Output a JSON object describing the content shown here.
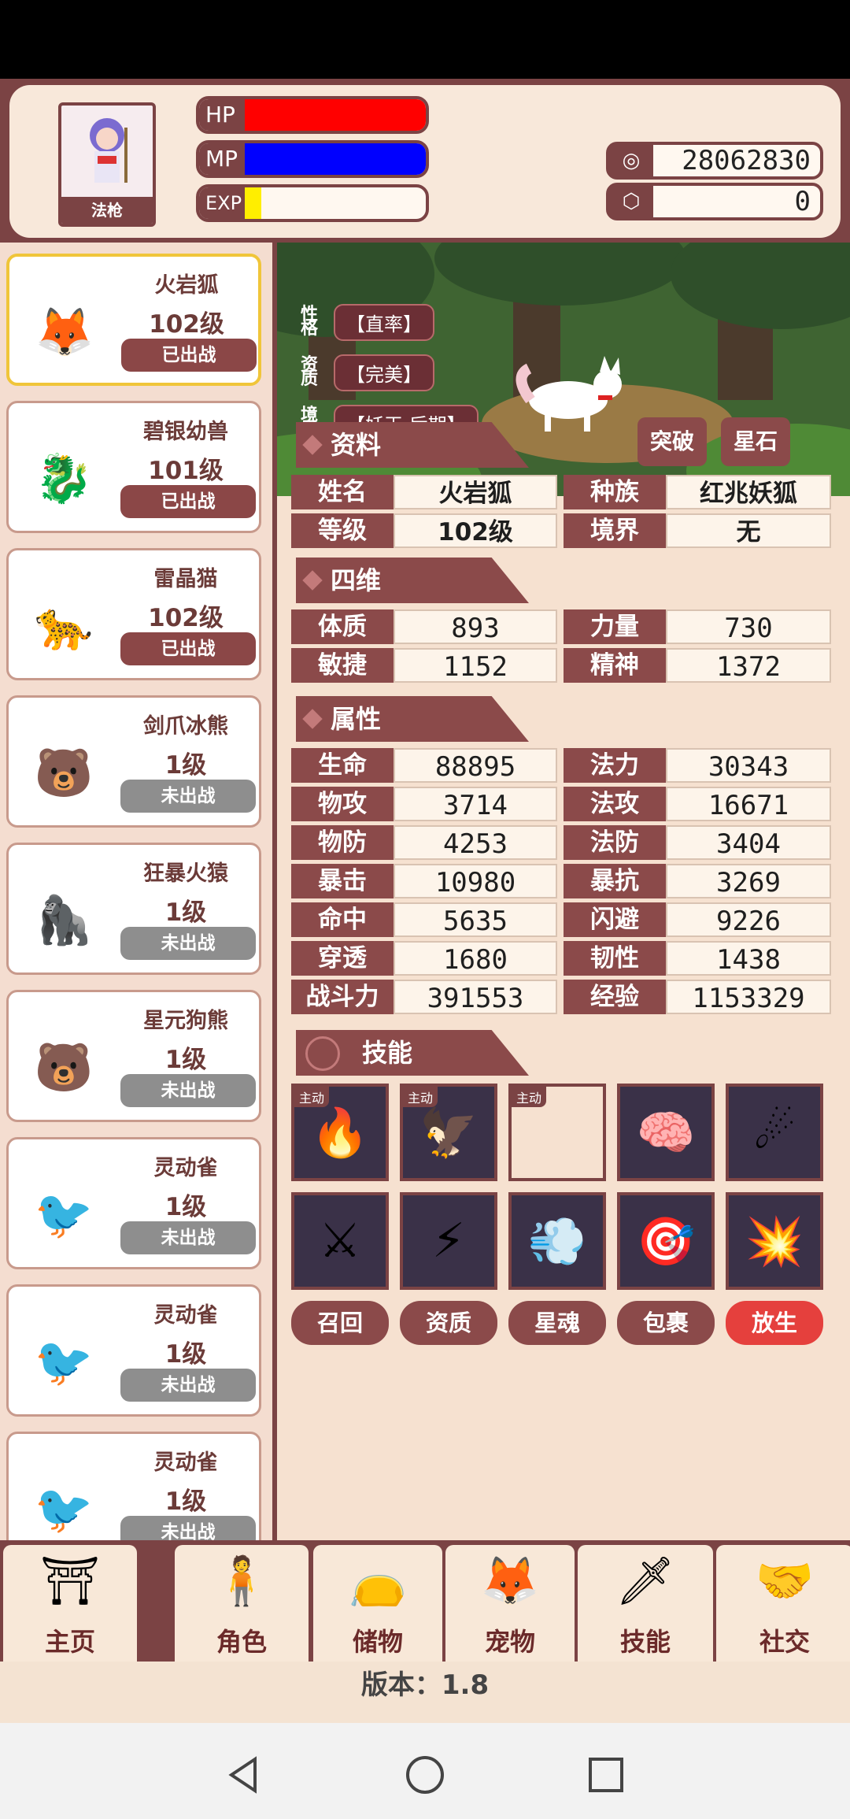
{
  "header": {
    "avatar_label": "法枪",
    "hp_label": "HP",
    "mp_label": "MP",
    "exp_label": "EXP",
    "hp_fill": 1.0,
    "mp_fill": 1.0,
    "exp_fill": 0.09,
    "hp_color": "#ff0000",
    "mp_color": "#0000ff",
    "exp_color": "#ffee00",
    "currency1_icon": "coin-icon",
    "currency1_value": "28062830",
    "currency2_icon": "gem-icon",
    "currency2_value": "0"
  },
  "pets": [
    {
      "name": "火岩狐",
      "level": "102级",
      "status": "已出战",
      "icon": "fox-icon"
    },
    {
      "name": "碧银幼兽",
      "level": "101级",
      "status": "已出战",
      "icon": "silver-beast-icon"
    },
    {
      "name": "雷晶猫",
      "level": "102级",
      "status": "已出战",
      "icon": "thunder-cat-icon"
    },
    {
      "name": "剑爪冰熊",
      "level": "1级",
      "status": "未出战",
      "icon": "ice-bear-icon"
    },
    {
      "name": "狂暴火猿",
      "level": "1级",
      "status": "未出战",
      "icon": "fire-ape-icon"
    },
    {
      "name": "星元狗熊",
      "level": "1级",
      "status": "未出战",
      "icon": "bear-icon"
    },
    {
      "name": "灵动雀",
      "level": "1级",
      "status": "未出战",
      "icon": "sparrow-icon"
    },
    {
      "name": "灵动雀",
      "level": "1级",
      "status": "未出战",
      "icon": "sparrow-icon"
    },
    {
      "name": "灵动雀",
      "level": "1级",
      "status": "未出战",
      "icon": "sparrow-icon"
    }
  ],
  "scene": {
    "traits": [
      {
        "label": "性格",
        "value": "【直率】"
      },
      {
        "label": "资质",
        "value": "【完美】"
      },
      {
        "label": "境界",
        "value": "【妖王·后期】"
      }
    ]
  },
  "info": {
    "section_title": "资料",
    "breakthrough_button": "突破",
    "starstone_button": "星石",
    "rows": [
      {
        "k1": "姓名",
        "v1": "火岩狐",
        "k2": "种族",
        "v2": "红兆妖狐"
      },
      {
        "k1": "等级",
        "v1": "102级",
        "k2": "境界",
        "v2": "无"
      }
    ]
  },
  "four_dims": {
    "section_title": "四维",
    "rows": [
      {
        "k1": "体质",
        "v1": "893",
        "k2": "力量",
        "v2": "730"
      },
      {
        "k1": "敏捷",
        "v1": "1152",
        "k2": "精神",
        "v2": "1372"
      }
    ]
  },
  "attributes": {
    "section_title": "属性",
    "rows": [
      {
        "k1": "生命",
        "v1": "88895",
        "k2": "法力",
        "v2": "30343"
      },
      {
        "k1": "物攻",
        "v1": "3714",
        "k2": "法攻",
        "v2": "16671"
      },
      {
        "k1": "物防",
        "v1": "4253",
        "k2": "法防",
        "v2": "3404"
      },
      {
        "k1": "暴击",
        "v1": "10980",
        "k2": "暴抗",
        "v2": "3269"
      },
      {
        "k1": "命中",
        "v1": "5635",
        "k2": "闪避",
        "v2": "9226"
      },
      {
        "k1": "穿透",
        "v1": "1680",
        "k2": "韧性",
        "v2": "1438"
      },
      {
        "k1": "战斗力",
        "v1": "391553",
        "k2": "经验",
        "v2": "1153329"
      }
    ]
  },
  "skills": {
    "section_title": "技能",
    "active_tag": "主动",
    "slots": [
      {
        "icon": "fire-mask-icon",
        "active": true
      },
      {
        "icon": "phoenix-mask-icon",
        "active": true
      },
      {
        "icon": "empty-slot-icon",
        "active": true
      },
      {
        "icon": "brain-icon",
        "active": false
      },
      {
        "icon": "fireball-icon",
        "active": false
      },
      {
        "icon": "slash-icon",
        "active": false
      },
      {
        "icon": "lightning-icon",
        "active": false
      },
      {
        "icon": "dash-icon",
        "active": false
      },
      {
        "icon": "target-icon",
        "active": false
      },
      {
        "icon": "flame-strike-icon",
        "active": false
      }
    ]
  },
  "actions": [
    "召回",
    "资质",
    "星魂",
    "包裹",
    "放生"
  ],
  "bottom_nav": [
    {
      "label": "主页",
      "icon": "home-gate-icon"
    },
    {
      "label": "角色",
      "icon": "character-icon"
    },
    {
      "label": "储物",
      "icon": "bag-icon"
    },
    {
      "label": "宠物",
      "icon": "pet-fox-icon"
    },
    {
      "label": "技能",
      "icon": "sword-icon"
    },
    {
      "label": "社交",
      "icon": "handshake-icon"
    }
  ],
  "version_text": "版本：1.8",
  "system_nav": {
    "back": "back-icon",
    "home": "home-icon",
    "recents": "recents-icon"
  }
}
